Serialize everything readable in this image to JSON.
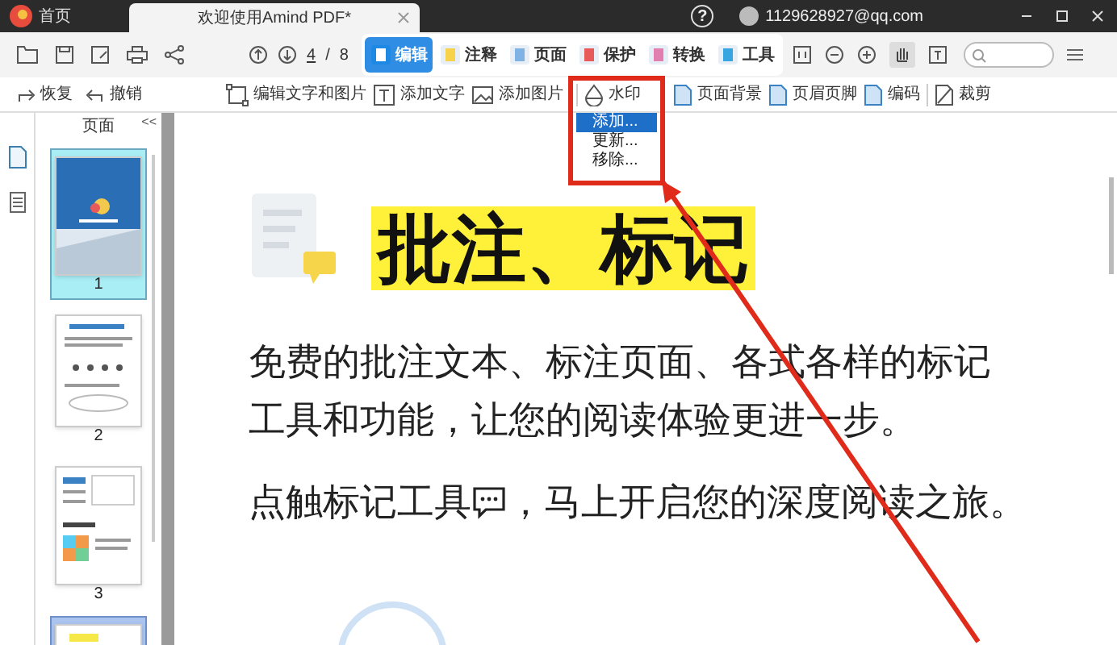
{
  "window": {
    "home_tab": "首页",
    "doc_tab": "欢迎使用Amind PDF*",
    "help": "?",
    "account": "1129628927@qq.com"
  },
  "toolbar": {
    "page_current": "4",
    "page_sep": "/",
    "page_total": "8",
    "modes": [
      {
        "label": "编辑",
        "selected": true
      },
      {
        "label": "注释",
        "selected": false
      },
      {
        "label": "页面",
        "selected": false
      },
      {
        "label": "保护",
        "selected": false
      },
      {
        "label": "转换",
        "selected": false
      },
      {
        "label": "工具",
        "selected": false
      }
    ]
  },
  "subtoolbar": {
    "history": [
      "恢复",
      "撤销"
    ],
    "tools": [
      {
        "label": "编辑文字和图片",
        "kind": "frame"
      },
      {
        "label": "添加文字",
        "kind": "text"
      },
      {
        "label": "添加图片",
        "kind": "image"
      },
      {
        "label": "水印",
        "kind": "drop"
      },
      {
        "label": "页面背景",
        "kind": "doc"
      },
      {
        "label": "页眉页脚",
        "kind": "doc"
      },
      {
        "label": "编码",
        "kind": "doc"
      },
      {
        "label": "裁剪",
        "kind": "crop"
      }
    ]
  },
  "watermark_menu": [
    {
      "label": "添加...",
      "selected": true
    },
    {
      "label": "更新...",
      "selected": false
    },
    {
      "label": "移除...",
      "selected": false
    }
  ],
  "sidebar": {
    "title": "页面",
    "collapse": "<<",
    "pages": [
      {
        "label": "1",
        "selected": true,
        "kind": "cover"
      },
      {
        "label": "2",
        "selected": false,
        "kind": "icons"
      },
      {
        "label": "3",
        "selected": false,
        "kind": "chart"
      },
      {
        "selected": true,
        "kind": "highlight"
      }
    ]
  },
  "document": {
    "title": "批注、标记",
    "paragraph": "免费的批注文本、标注页面、各式各样的标记工具和功能，让您的阅读体验更进一步。",
    "line_before": "点触标记工具",
    "line_after": "，马上开启您的深度阅读之旅。"
  }
}
